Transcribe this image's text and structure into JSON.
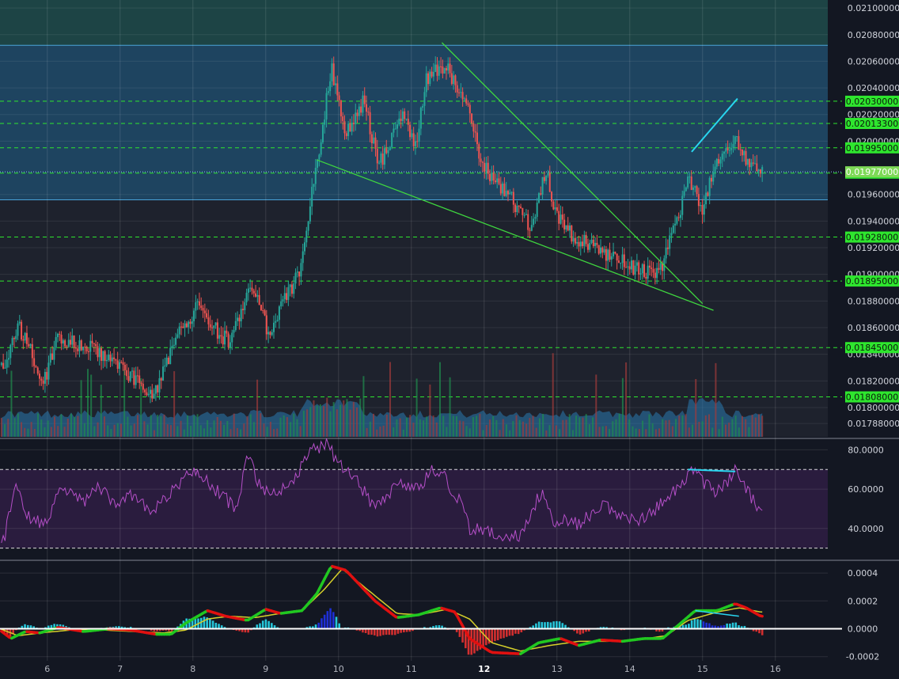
{
  "chart_data": [
    {
      "type": "candlestick",
      "panel": "price",
      "y_axis": {
        "min": 0.01778,
        "max": 0.02106,
        "ticks": [
          "0.02100000",
          "0.02080000",
          "0.02060000",
          "0.02040000",
          "0.02020000",
          "0.02000000",
          "0.01960000",
          "0.01940000",
          "0.01920000",
          "0.01900000",
          "0.01880000",
          "0.01860000",
          "0.01840000",
          "0.01820000",
          "0.01800000",
          "0.01788000"
        ]
      },
      "x_axis": {
        "min": 5.35,
        "max": 16.72,
        "ticks": [
          "6",
          "7",
          "8",
          "9",
          "10",
          "11",
          "12",
          "13",
          "14",
          "15",
          "16"
        ],
        "bold_tick": "12"
      },
      "price_key_points": [
        [
          5.4,
          0.01832
        ],
        [
          5.6,
          0.01862
        ],
        [
          5.95,
          0.0182
        ],
        [
          6.15,
          0.01852
        ],
        [
          6.5,
          0.01847
        ],
        [
          6.75,
          0.0184
        ],
        [
          7.1,
          0.01825
        ],
        [
          7.45,
          0.01808
        ],
        [
          7.75,
          0.0185
        ],
        [
          8.05,
          0.01875
        ],
        [
          8.5,
          0.01848
        ],
        [
          8.8,
          0.01893
        ],
        [
          9.05,
          0.01855
        ],
        [
          9.2,
          0.01875
        ],
        [
          9.45,
          0.019
        ],
        [
          9.75,
          0.02
        ],
        [
          9.9,
          0.02055
        ],
        [
          10.1,
          0.02005
        ],
        [
          10.35,
          0.0203
        ],
        [
          10.55,
          0.01982
        ],
        [
          10.9,
          0.0202
        ],
        [
          11.05,
          0.01993
        ],
        [
          11.2,
          0.02045
        ],
        [
          11.5,
          0.0206
        ],
        [
          11.6,
          0.0204
        ],
        [
          11.75,
          0.0203
        ],
        [
          11.95,
          0.01985
        ],
        [
          12.2,
          0.01965
        ],
        [
          12.4,
          0.01955
        ],
        [
          12.65,
          0.01935
        ],
        [
          12.85,
          0.0198
        ],
        [
          12.95,
          0.0195
        ],
        [
          13.2,
          0.0193
        ],
        [
          13.5,
          0.0192
        ],
        [
          13.8,
          0.01912
        ],
        [
          14.05,
          0.01905
        ],
        [
          14.4,
          0.019
        ],
        [
          14.6,
          0.01932
        ],
        [
          14.8,
          0.0197
        ],
        [
          15.0,
          0.0195
        ],
        [
          15.2,
          0.01985
        ],
        [
          15.45,
          0.02005
        ],
        [
          15.6,
          0.01985
        ],
        [
          15.8,
          0.01977
        ]
      ],
      "current_price": "0.01977000",
      "horizontal_levels": [
        "0.02030000",
        "0.02013300",
        "0.01995000",
        "0.01976000",
        "0.01928000",
        "0.01895000",
        "0.01845000",
        "0.01808000"
      ],
      "zones": [
        {
          "name": "upper-zone",
          "from": 0.01956,
          "to": 0.02072,
          "color": "#1f4a6a"
        },
        {
          "name": "top-zone",
          "from": 0.02072,
          "to": 0.02106,
          "color": "#1d4a4a"
        }
      ],
      "trendlines": [
        {
          "from": [
            9.7,
            0.01986
          ],
          "to": [
            15.15,
            0.01873
          ],
          "color": "#3fd63f"
        },
        {
          "from": [
            11.42,
            0.02074
          ],
          "to": [
            15.0,
            0.01878
          ],
          "color": "#3fd63f"
        },
        {
          "from": [
            14.85,
            0.01992
          ],
          "to": [
            15.48,
            0.02032
          ],
          "color": "#29d6f0"
        }
      ],
      "colors": {
        "up": "#26a69a",
        "down": "#ef5350",
        "level": "#2ee62e",
        "label_bg": "#2ee62e",
        "current_label_bg": "#7ed957"
      }
    },
    {
      "type": "area",
      "panel": "volume",
      "series": [
        {
          "name": "volume",
          "color": "#2a7ab0"
        }
      ]
    },
    {
      "type": "line",
      "panel": "rsi",
      "y_axis": {
        "min": 25,
        "max": 85,
        "ticks": [
          "80.0000",
          "60.0000",
          "40.0000"
        ]
      },
      "band": [
        30,
        70
      ],
      "key_points": [
        [
          5.4,
          33
        ],
        [
          5.55,
          62
        ],
        [
          5.75,
          45
        ],
        [
          5.95,
          42
        ],
        [
          6.2,
          60
        ],
        [
          6.5,
          54
        ],
        [
          6.7,
          62
        ],
        [
          6.95,
          50
        ],
        [
          7.15,
          58
        ],
        [
          7.45,
          48
        ],
        [
          7.75,
          60
        ],
        [
          8.0,
          70
        ],
        [
          8.3,
          60
        ],
        [
          8.6,
          50
        ],
        [
          8.75,
          78
        ],
        [
          8.95,
          58
        ],
        [
          9.2,
          60
        ],
        [
          9.45,
          68
        ],
        [
          9.6,
          80
        ],
        [
          9.85,
          83
        ],
        [
          10.0,
          72
        ],
        [
          10.2,
          67
        ],
        [
          10.5,
          50
        ],
        [
          10.8,
          62
        ],
        [
          11.1,
          60
        ],
        [
          11.3,
          70
        ],
        [
          11.45,
          66
        ],
        [
          11.65,
          55
        ],
        [
          11.8,
          40
        ],
        [
          12.05,
          38
        ],
        [
          12.3,
          35
        ],
        [
          12.5,
          37
        ],
        [
          12.8,
          60
        ],
        [
          12.95,
          44
        ],
        [
          13.1,
          45
        ],
        [
          13.3,
          42
        ],
        [
          13.6,
          52
        ],
        [
          13.9,
          47
        ],
        [
          14.2,
          44
        ],
        [
          14.5,
          55
        ],
        [
          14.7,
          62
        ],
        [
          14.85,
          70
        ],
        [
          15.0,
          64
        ],
        [
          15.2,
          58
        ],
        [
          15.45,
          69
        ],
        [
          15.6,
          60
        ],
        [
          15.75,
          52
        ]
      ],
      "divergence_line": {
        "from": [
          14.8,
          70
        ],
        "to": [
          15.45,
          69
        ],
        "color": "#29d6f0"
      },
      "color": "#b54fc8"
    },
    {
      "type": "macd",
      "panel": "macd",
      "y_axis": {
        "min": -0.00023,
        "max": 0.00048,
        "ticks": [
          "0.0004",
          "0.0002",
          "0.0000",
          "-0.0002"
        ]
      },
      "macd_key_points": [
        [
          5.35,
          -1e-05
        ],
        [
          5.5,
          -7e-05
        ],
        [
          5.7,
          -2e-05
        ],
        [
          5.9,
          -3e-05
        ],
        [
          6.15,
          1e-05
        ],
        [
          6.5,
          -2e-05
        ],
        [
          6.85,
          0.0
        ],
        [
          7.15,
          -1e-05
        ],
        [
          7.5,
          -4e-05
        ],
        [
          7.7,
          -4e-05
        ],
        [
          7.9,
          4e-05
        ],
        [
          8.2,
          0.00013
        ],
        [
          8.45,
          9e-05
        ],
        [
          8.75,
          6e-05
        ],
        [
          9.0,
          0.00014
        ],
        [
          9.2,
          0.00011
        ],
        [
          9.5,
          0.00013
        ],
        [
          9.7,
          0.00025
        ],
        [
          9.9,
          0.00045
        ],
        [
          10.1,
          0.00042
        ],
        [
          10.5,
          0.0002
        ],
        [
          10.8,
          8e-05
        ],
        [
          11.1,
          0.0001
        ],
        [
          11.4,
          0.00015
        ],
        [
          11.6,
          0.00012
        ],
        [
          11.8,
          -7e-05
        ],
        [
          12.1,
          -0.00017
        ],
        [
          12.5,
          -0.00018
        ],
        [
          12.75,
          -0.0001
        ],
        [
          13.05,
          -7e-05
        ],
        [
          13.3,
          -0.00012
        ],
        [
          13.6,
          -8e-05
        ],
        [
          13.9,
          -9e-05
        ],
        [
          14.2,
          -7e-05
        ],
        [
          14.45,
          -7e-05
        ],
        [
          14.7,
          4e-05
        ],
        [
          14.9,
          0.00013
        ],
        [
          15.2,
          0.00013
        ],
        [
          15.45,
          0.00018
        ],
        [
          15.6,
          0.00015
        ],
        [
          15.8,
          9e-05
        ]
      ],
      "signal_key_points": [
        [
          5.35,
          0.0
        ],
        [
          5.6,
          -5e-05
        ],
        [
          5.9,
          -3e-05
        ],
        [
          6.3,
          -1e-05
        ],
        [
          6.8,
          -1e-05
        ],
        [
          7.2,
          -2e-05
        ],
        [
          7.6,
          -3e-05
        ],
        [
          7.9,
          -1e-05
        ],
        [
          8.2,
          7e-05
        ],
        [
          8.5,
          9e-05
        ],
        [
          8.85,
          8e-05
        ],
        [
          9.2,
          0.00011
        ],
        [
          9.5,
          0.00013
        ],
        [
          9.8,
          0.00028
        ],
        [
          10.05,
          0.00043
        ],
        [
          10.4,
          0.00028
        ],
        [
          10.8,
          0.00011
        ],
        [
          11.1,
          0.0001
        ],
        [
          11.5,
          0.00014
        ],
        [
          11.8,
          7e-05
        ],
        [
          12.1,
          -0.0001
        ],
        [
          12.5,
          -0.00016
        ],
        [
          12.9,
          -0.00012
        ],
        [
          13.3,
          -9e-05
        ],
        [
          13.7,
          -9e-05
        ],
        [
          14.1,
          -8e-05
        ],
        [
          14.5,
          -5e-05
        ],
        [
          14.8,
          6e-05
        ],
        [
          15.2,
          0.00012
        ],
        [
          15.5,
          0.00015
        ],
        [
          15.8,
          0.00012
        ]
      ],
      "histogram_color_pos": "#26c6da",
      "histogram_color_pos_dark": "#1e2fd6",
      "histogram_color_neg": "#d32f2f",
      "macd_color_up": "#21c821",
      "macd_color_down": "#e01010",
      "signal_color": "#d6d02a",
      "zero_line_color": "#ffffff",
      "divergence_line": {
        "from": [
          14.9,
          0.00013
        ],
        "to": [
          15.5,
          9e-05
        ],
        "color": "#29d6f0"
      }
    }
  ]
}
